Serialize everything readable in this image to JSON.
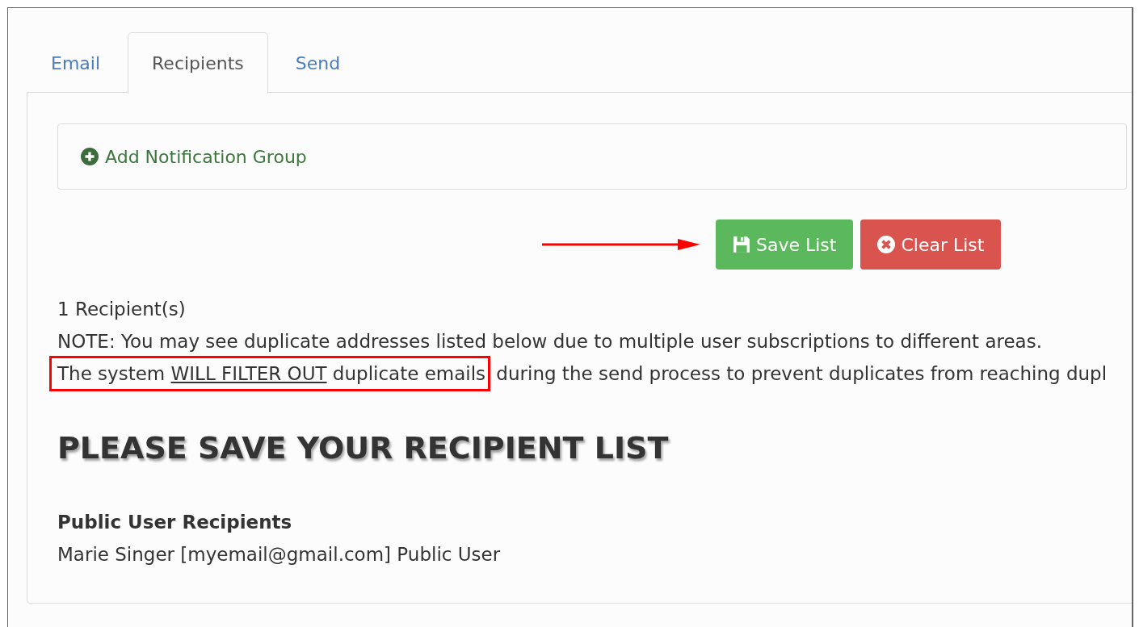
{
  "tabs": [
    {
      "label": "Email",
      "selected": false
    },
    {
      "label": "Recipients",
      "selected": true
    },
    {
      "label": "Send",
      "selected": false
    }
  ],
  "add_group": {
    "label": "Add Notification Group"
  },
  "buttons": [
    {
      "label": "Save List",
      "kind": "save"
    },
    {
      "label": "Clear List",
      "kind": "clear"
    }
  ],
  "recipient_count": "1 Recipient(s)",
  "note": "NOTE: You may see duplicate addresses listed below due to multiple user subscriptions to different areas.",
  "filter_note": {
    "segments": [
      {
        "text": "The system ",
        "underlined": false,
        "highlighted": true
      },
      {
        "text": "WILL FILTER OUT",
        "underlined": true,
        "highlighted": true
      },
      {
        "text": " duplicate emails",
        "underlined": false,
        "highlighted": true
      },
      {
        "text": " during the send process to prevent duplicates from reaching dupl",
        "underlined": false,
        "highlighted": false
      }
    ]
  },
  "heading": "PLEASE SAVE YOUR RECIPIENT LIST",
  "section": {
    "title": "Public User Recipients",
    "entries": [
      "Marie Singer [myemail@gmail.com] Public User"
    ]
  }
}
